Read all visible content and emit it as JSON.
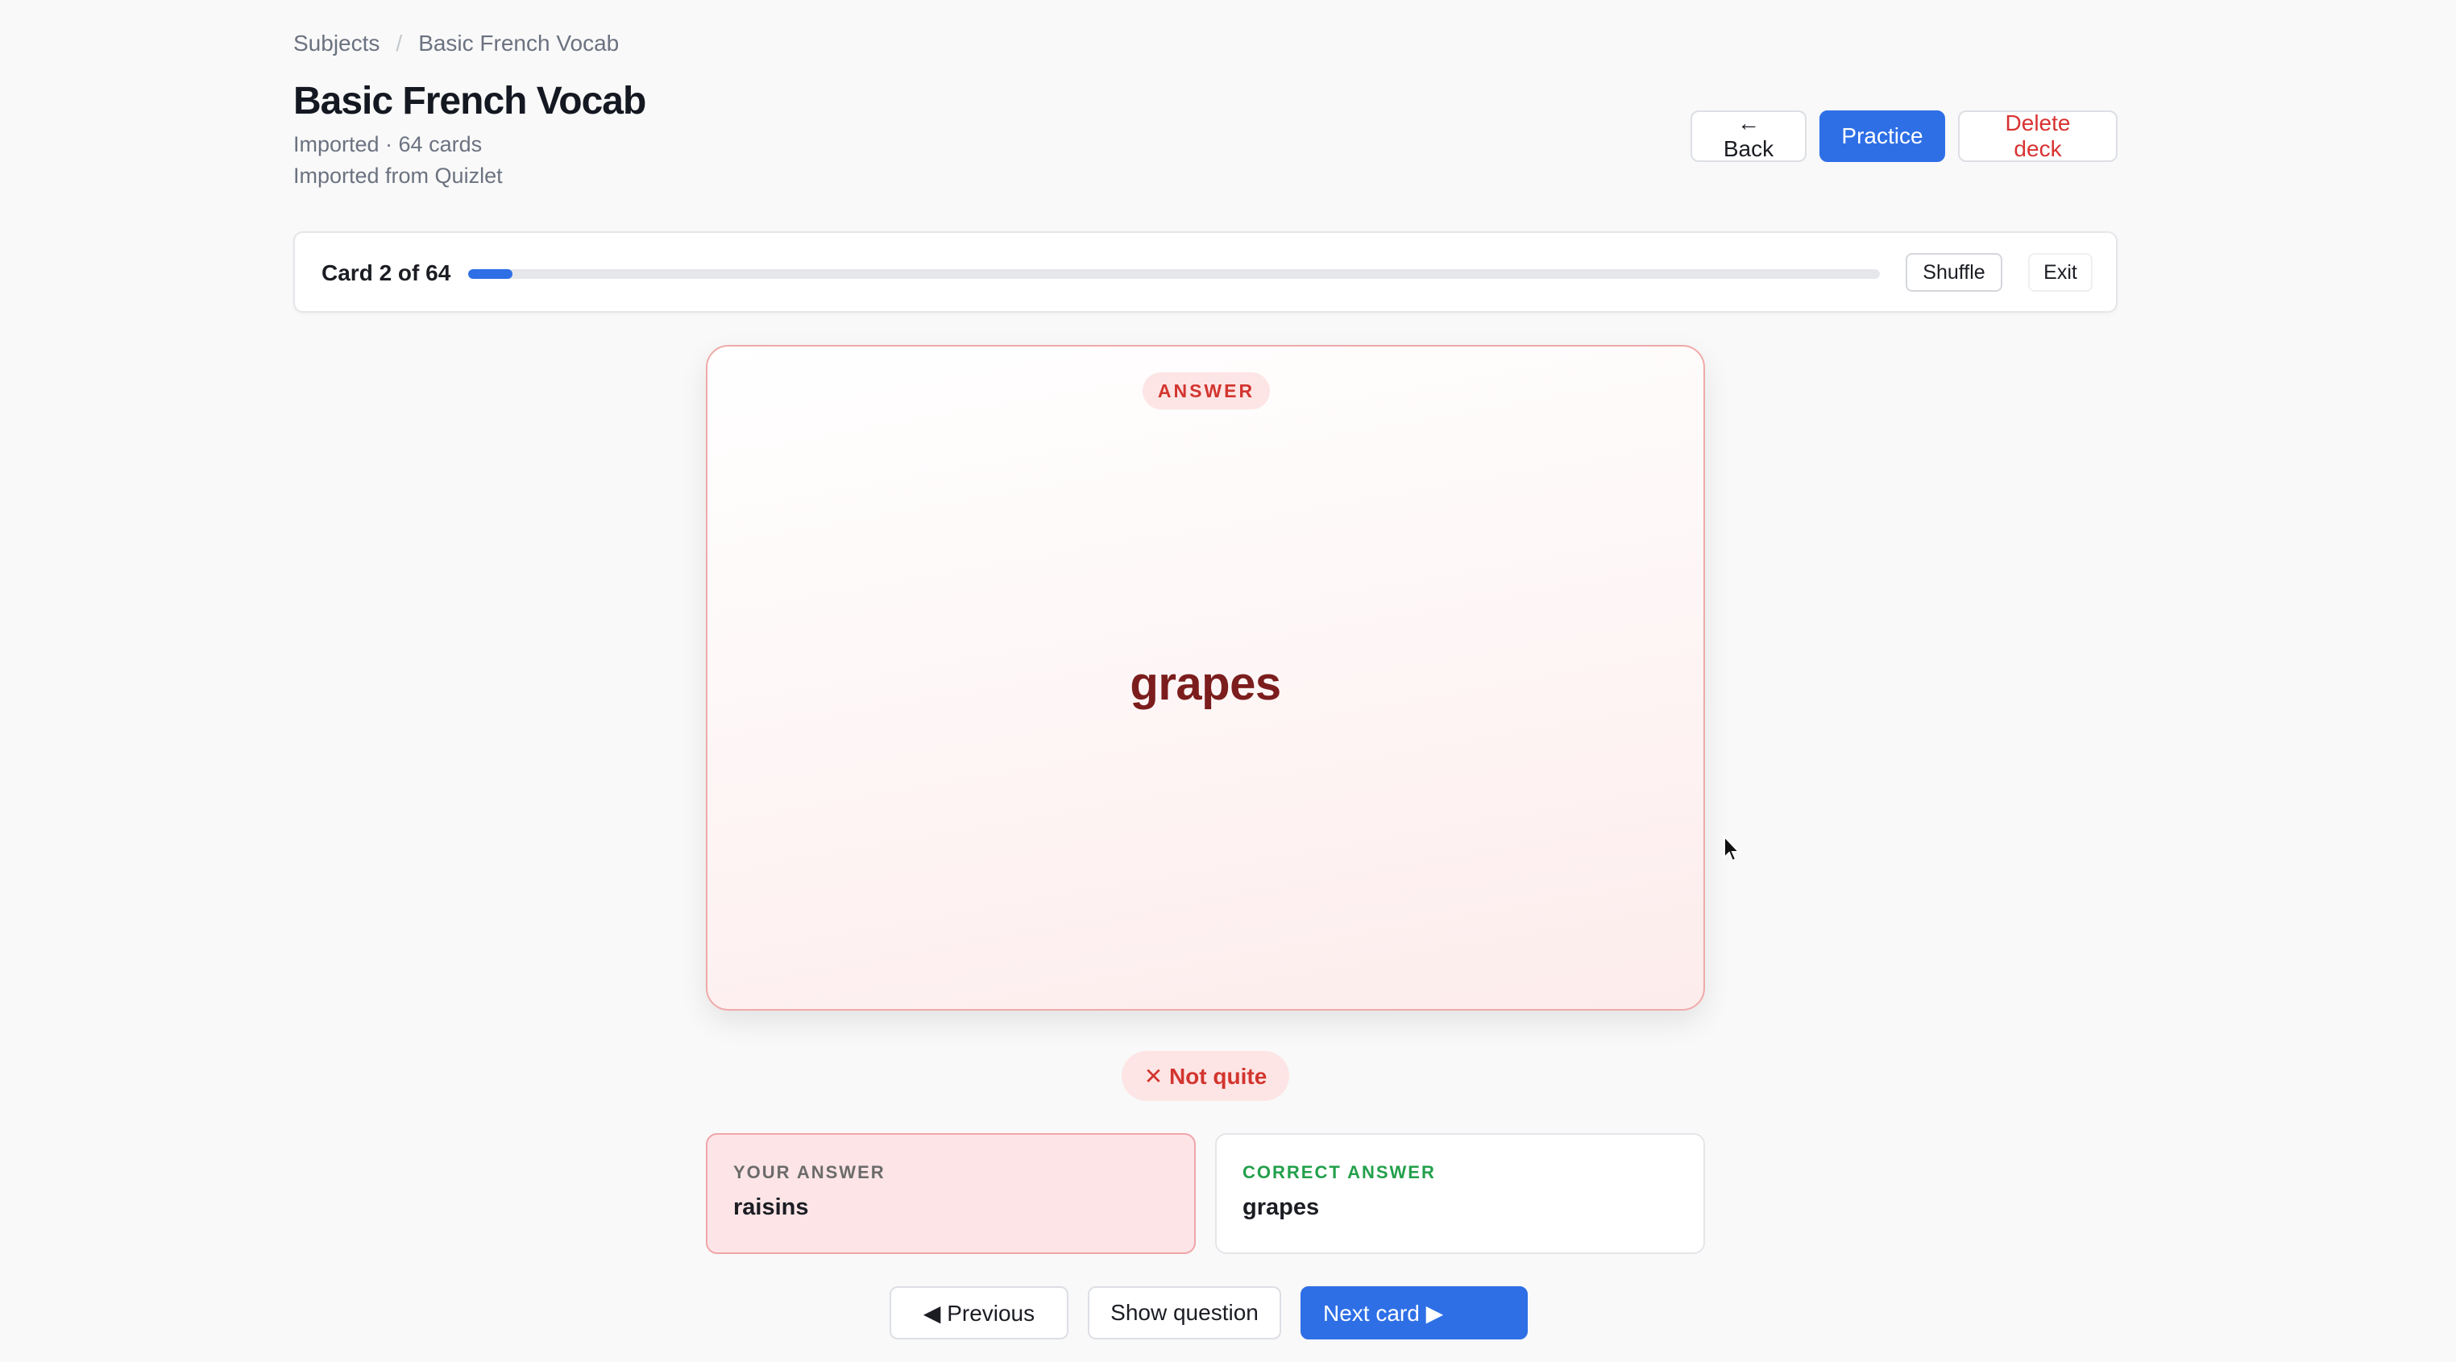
{
  "breadcrumb": {
    "root": "Subjects",
    "separator": "/",
    "current": "Basic French Vocab"
  },
  "deck": {
    "title": "Basic French Vocab",
    "meta": "Imported · 64 cards",
    "source": "Imported from Quizlet"
  },
  "header_actions": {
    "back_label": "← Back",
    "practice_label": "Practice",
    "delete_label": "Delete deck"
  },
  "progress": {
    "label": "Card 2 of 64",
    "current": 2,
    "total": 64,
    "shuffle_label": "Shuffle",
    "exit_label": "Exit"
  },
  "card": {
    "side_label": "ANSWER",
    "text": "grapes"
  },
  "result": {
    "icon": "close-icon",
    "label": "✕ Not quite"
  },
  "your_answer": {
    "label": "YOUR ANSWER",
    "value": "raisins"
  },
  "correct_answer": {
    "label": "CORRECT ANSWER",
    "value": "grapes"
  },
  "footer": {
    "previous_label": "◀ Previous",
    "show_question_label": "Show question",
    "next_label": "Next card ▶"
  },
  "colors": {
    "accent": "#2e6fe6",
    "danger": "#d2352f",
    "success": "#22a04b",
    "card_text": "#7c1d1d"
  }
}
